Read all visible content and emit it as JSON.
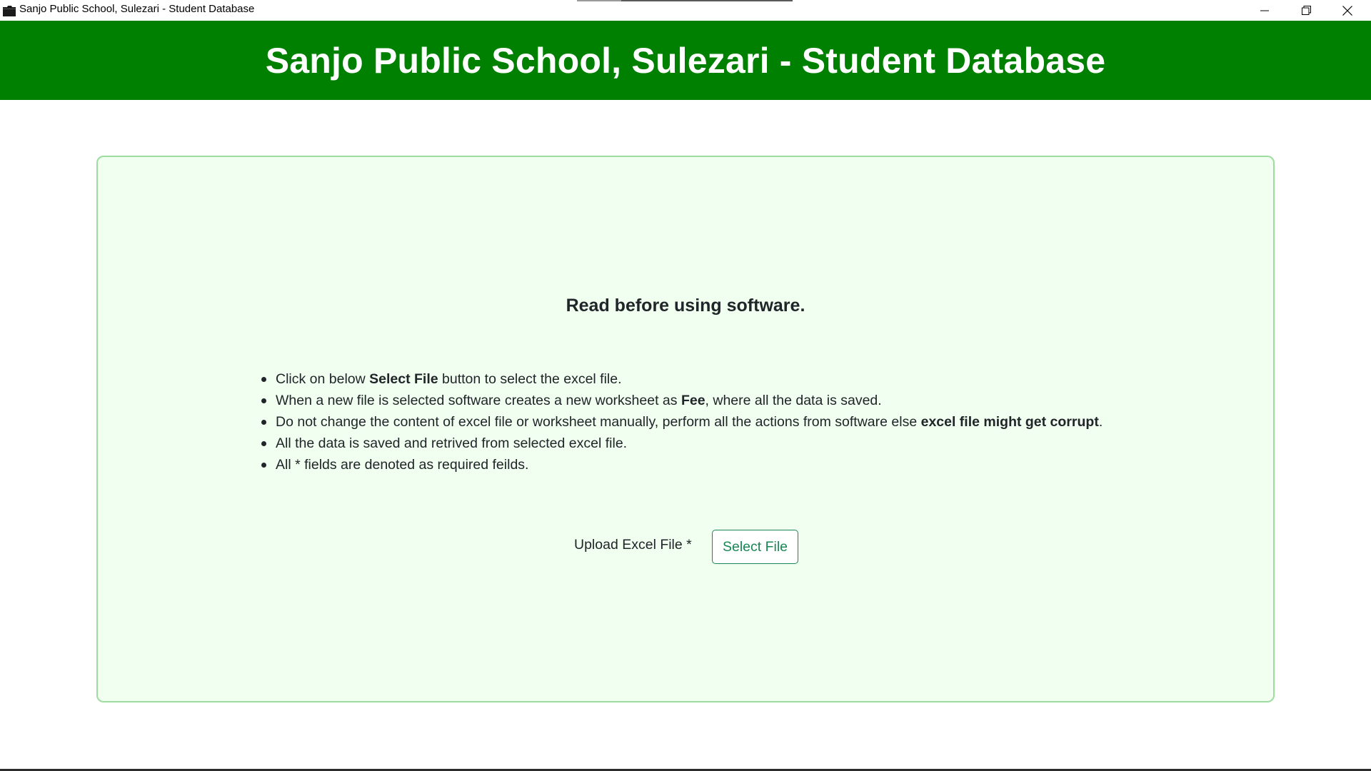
{
  "window": {
    "title": "Sanjo Public School, Sulezari - Student Database",
    "app_icon": "folder-icon",
    "controls": {
      "minimize_icon": "minimize-icon",
      "maximize_icon": "restore-icon",
      "close_icon": "close-icon"
    }
  },
  "header": {
    "title": "Sanjo Public School, Sulezari - Student Database",
    "background_color": "#008000",
    "text_color": "#ffffff"
  },
  "card": {
    "heading": "Read before using software.",
    "background_color": "#f0fff0",
    "border_color": "#9fdc9f",
    "instructions": [
      {
        "before": "Click on below ",
        "bold": "Select File",
        "after": " button to select the excel file."
      },
      {
        "before": "When a new file is selected software creates a new worksheet as ",
        "bold": "Fee",
        "after": ", where all the data is saved."
      },
      {
        "before": "Do not change the content of excel file or worksheet manually, perform all the actions from software else ",
        "bold": "excel file might get corrupt",
        "after": "."
      },
      {
        "before": "All the data is saved and retrived from selected excel file.",
        "bold": "",
        "after": ""
      },
      {
        "before": "All * fields are denoted as required feilds.",
        "bold": "",
        "after": ""
      }
    ],
    "upload": {
      "label": "Upload Excel File *",
      "button_label": "Select File",
      "button_color": "#198754"
    }
  }
}
